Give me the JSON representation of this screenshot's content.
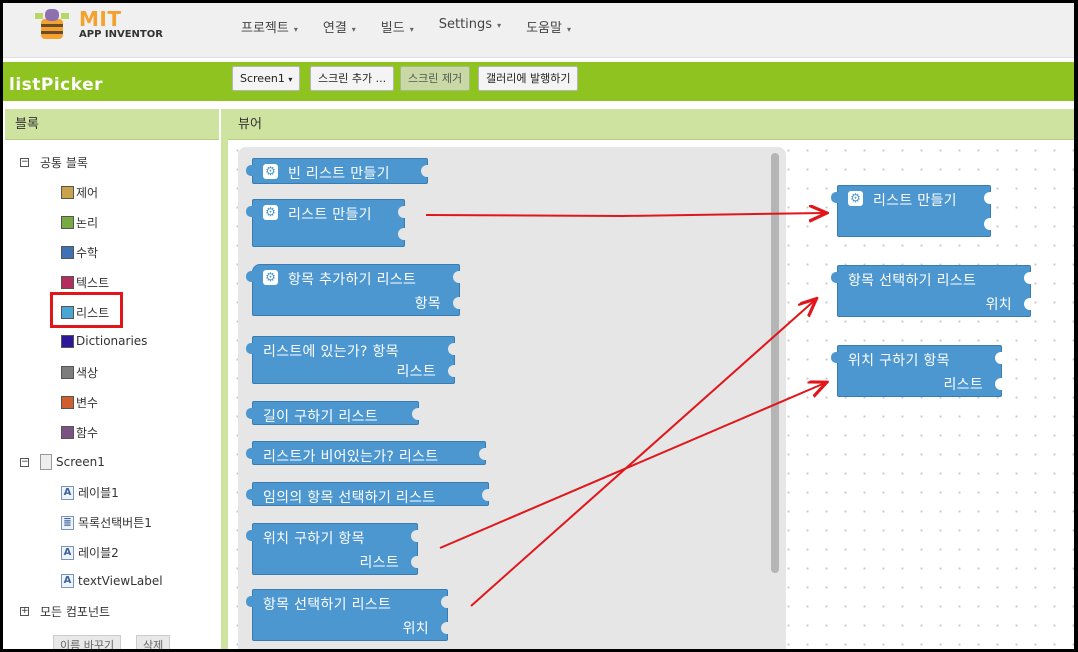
{
  "header": {
    "logo_mit": "MIT",
    "logo_sub": "APP INVENTOR",
    "menu": [
      "프로젝트",
      "연결",
      "빌드",
      "Settings",
      "도움말"
    ]
  },
  "project": {
    "name": "listPicker",
    "screen_select": "Screen1",
    "add_screen": "스크린 추가 ...",
    "remove_screen": "스크린 제거",
    "publish_gallery": "갤러리에 발행하기"
  },
  "blocks_panel": {
    "title": "블록",
    "builtin_label": "공통 블록",
    "builtin": [
      {
        "label": "제어",
        "color": "#c8a24c"
      },
      {
        "label": "논리",
        "color": "#77ab41"
      },
      {
        "label": "수학",
        "color": "#3f71b5"
      },
      {
        "label": "텍스트",
        "color": "#b32d5e"
      },
      {
        "label": "리스트",
        "color": "#49a6d4"
      },
      {
        "label": "Dictionaries",
        "color": "#2d1799"
      },
      {
        "label": "색상",
        "color": "#7d7d7d"
      },
      {
        "label": "변수",
        "color": "#d05f2d"
      },
      {
        "label": "함수",
        "color": "#7c5385"
      }
    ],
    "screen_label": "Screen1",
    "components": [
      "레이블1",
      "목록선택버튼1",
      "레이블2",
      "textViewLabel"
    ],
    "all_components": "모든 컴포넌트",
    "rename_button": "이름 바꾸기",
    "delete_button": "삭제"
  },
  "viewer": {
    "title": "뷰어",
    "flyout_blocks": [
      {
        "line1": "빈 리스트 만들기",
        "line2": ""
      },
      {
        "line1": "리스트 만들기",
        "line2": ""
      },
      {
        "line1": "항목 추가하기 리스트",
        "line2": "항목"
      },
      {
        "line1": "리스트에 있는가?  항목",
        "line2": "리스트"
      },
      {
        "line1": "길이 구하기 리스트",
        "line2": ""
      },
      {
        "line1": "리스트가 비어있는가? 리스트",
        "line2": ""
      },
      {
        "line1": "임의의 항목 선택하기 리스트",
        "line2": ""
      },
      {
        "line1": "위치 구하기   항목",
        "line2": "리스트"
      },
      {
        "line1": "항목 선택하기   리스트",
        "line2": "위치"
      }
    ],
    "workspace_blocks": [
      {
        "line1": "리스트 만들기",
        "line2": ""
      },
      {
        "line1": "항목 선택하기   리스트",
        "line2": "위치"
      },
      {
        "line1": "위치 구하기   항목",
        "line2": "리스트"
      }
    ]
  },
  "colors": {
    "brand_green": "#8fc31f",
    "panel_header": "#cfe3a0",
    "block_blue": "#4c97d0",
    "annotation_red": "#e0161b"
  }
}
